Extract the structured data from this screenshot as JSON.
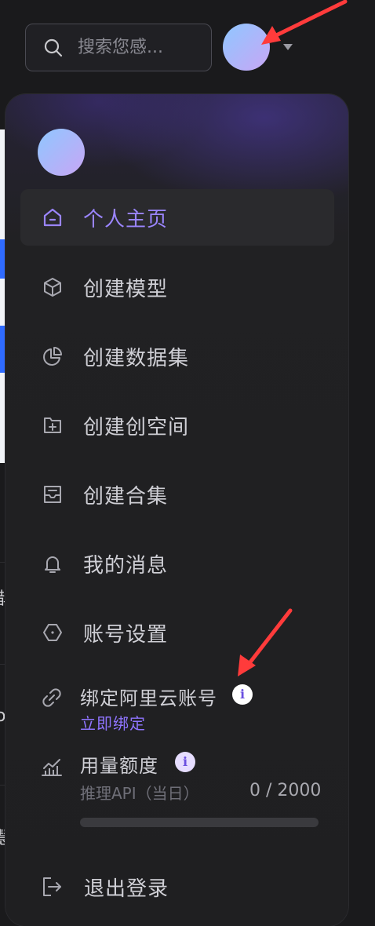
{
  "background": {
    "fragments": [
      "鹊",
      "o",
      "慧"
    ]
  },
  "header": {
    "search_placeholder": "搜索您感..."
  },
  "menu": {
    "items": [
      {
        "label": "个人主页",
        "icon": "home-icon",
        "active": true
      },
      {
        "label": "创建模型",
        "icon": "cube-icon",
        "active": false
      },
      {
        "label": "创建数据集",
        "icon": "pie-chart-icon",
        "active": false
      },
      {
        "label": "创建创空间",
        "icon": "folder-plus-icon",
        "active": false
      },
      {
        "label": "创建合集",
        "icon": "inbox-icon",
        "active": false
      },
      {
        "label": "我的消息",
        "icon": "bell-icon",
        "active": false
      },
      {
        "label": "账号设置",
        "icon": "hexagon-settings-icon",
        "active": false
      }
    ],
    "bind_account": {
      "label": "绑定阿里云账号",
      "info": "i",
      "link": "立即绑定"
    },
    "quota": {
      "label": "用量额度",
      "info": "i",
      "sub_label": "推理API（当日）",
      "value_text": "0 / 2000",
      "used": 0,
      "total": 2000
    },
    "logout_label": "退出登录"
  },
  "colors": {
    "accent": "#8f74ff",
    "arrow": "#ff3b3b"
  }
}
